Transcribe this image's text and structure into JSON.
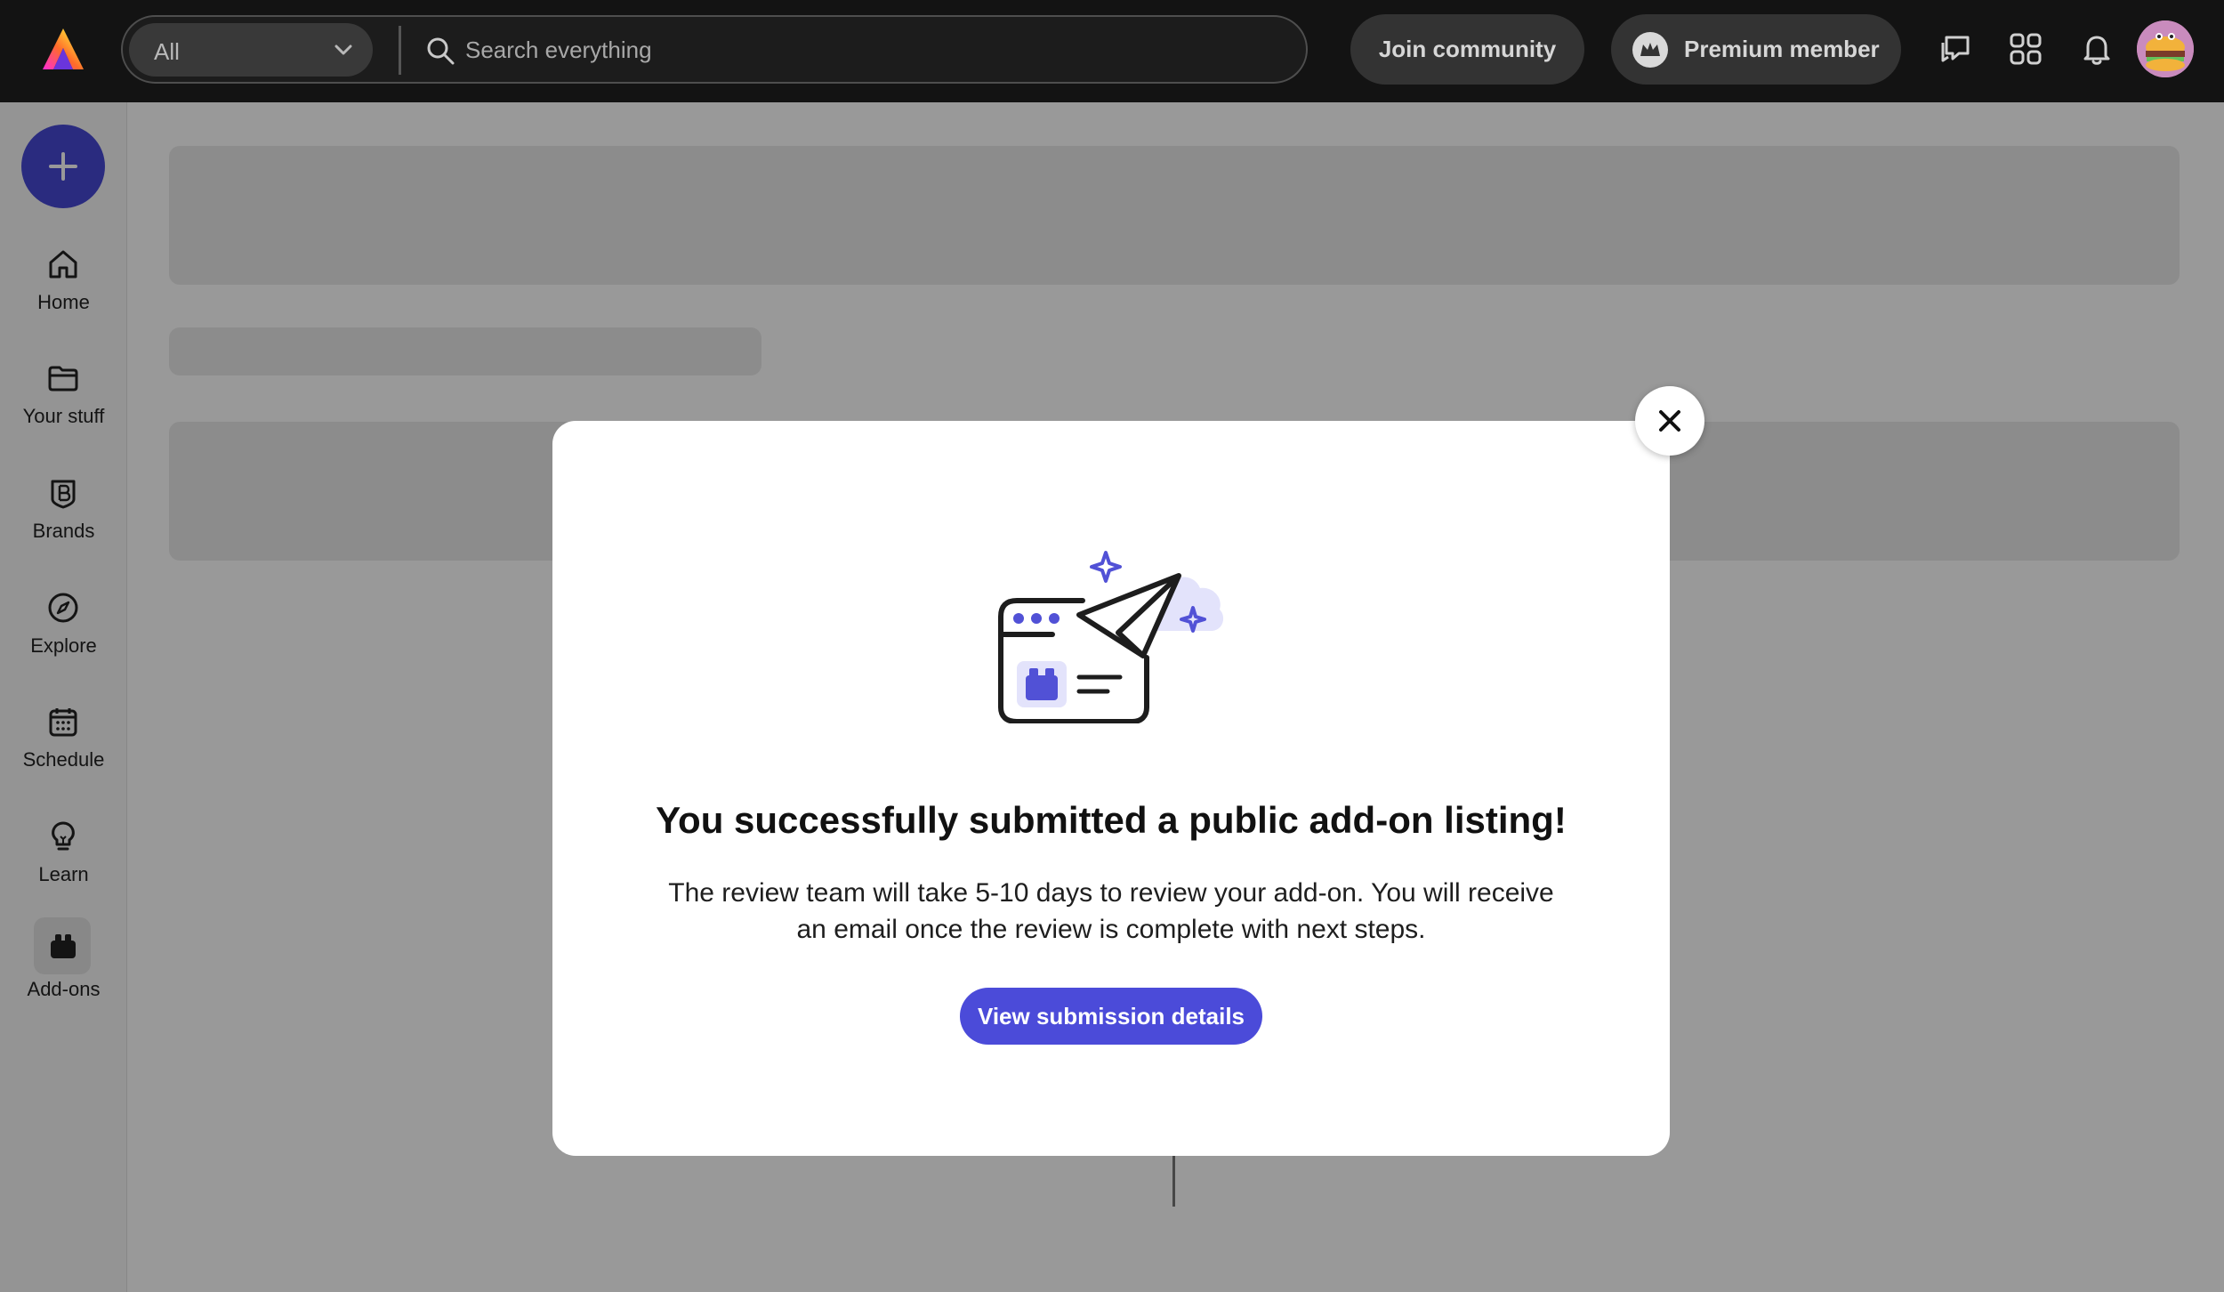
{
  "topbar": {
    "logo_icon": "adobe-express-logo-icon",
    "search": {
      "scope_value": "All",
      "placeholder": "Search everything"
    },
    "join_community_label": "Join community",
    "premium_label": "Premium member",
    "icons": [
      "chat-icon",
      "apps-grid-icon",
      "bell-icon",
      "avatar"
    ]
  },
  "sidebar": {
    "create_icon": "plus-icon",
    "items": [
      {
        "label": "Home",
        "icon": "home-icon"
      },
      {
        "label": "Your stuff",
        "icon": "folder-icon"
      },
      {
        "label": "Brands",
        "icon": "brands-icon"
      },
      {
        "label": "Explore",
        "icon": "compass-icon"
      },
      {
        "label": "Schedule",
        "icon": "calendar-icon"
      },
      {
        "label": "Learn",
        "icon": "lightbulb-icon"
      },
      {
        "label": "Add-ons",
        "icon": "add-ons-icon",
        "active": true
      }
    ]
  },
  "modal": {
    "title": "You successfully submitted a public add-on listing!",
    "body": "The review team will take 5-10 days to review your add-on. You will receive an email once the review is complete with next steps.",
    "button_label": "View submission details",
    "illustration": "paper-plane-submission-icon"
  },
  "colors": {
    "accent": "#4B4BD9",
    "topbar": "#131313",
    "create_button": "#4648D4"
  }
}
